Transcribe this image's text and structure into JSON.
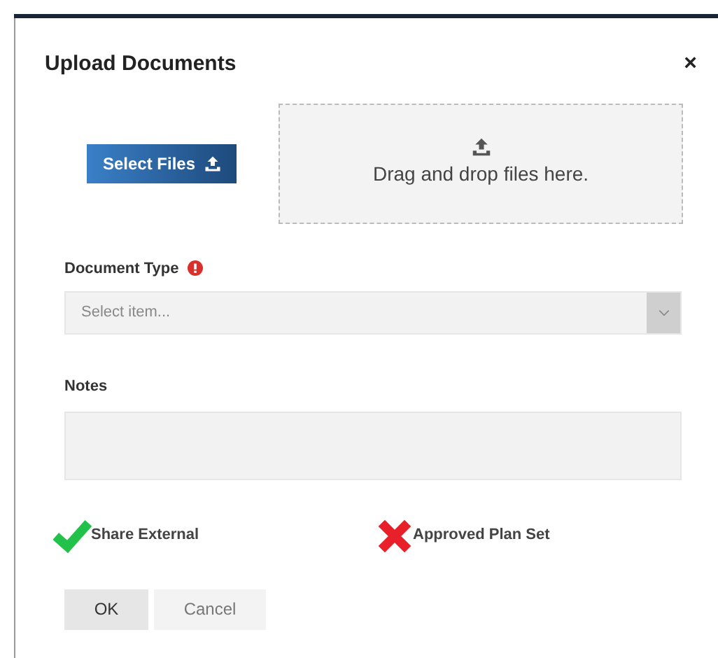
{
  "dialog": {
    "title": "Upload Documents",
    "close": "×"
  },
  "upload": {
    "button": "Select Files",
    "dropzone": "Drag and drop files here."
  },
  "document_type": {
    "label": "Document Type",
    "required": true,
    "placeholder": "Select item..."
  },
  "notes": {
    "label": "Notes"
  },
  "options": [
    {
      "label": "Share External",
      "checked": true
    },
    {
      "label": "Approved Plan Set",
      "checked": false
    }
  ],
  "buttons": [
    {
      "label": "OK",
      "selected": true
    },
    {
      "label": "Cancel",
      "selected": false
    }
  ]
}
